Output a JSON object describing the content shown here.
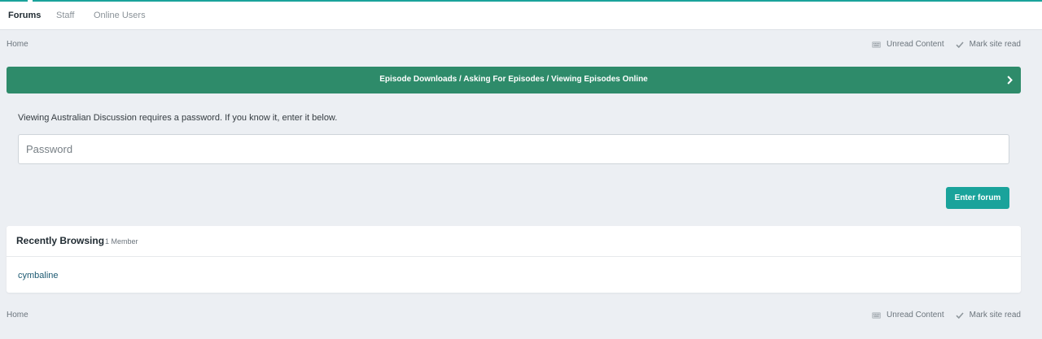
{
  "nav": {
    "tabs": [
      {
        "label": "Forums",
        "active": true
      },
      {
        "label": "Staff",
        "active": false
      },
      {
        "label": "Online Users",
        "active": false
      }
    ]
  },
  "breadcrumb_top": {
    "home": "Home",
    "unread": "Unread Content",
    "mark_read": "Mark site read"
  },
  "banner": {
    "text": "Episode Downloads / Asking For Episodes / Viewing Episodes Online",
    "color": "#2e8b6a"
  },
  "password_prompt": {
    "message": "Viewing Australian Discussion requires a password. If you know it, enter it below.",
    "placeholder": "Password",
    "value": "",
    "button": "Enter forum"
  },
  "recently_browsing": {
    "title": "Recently Browsing",
    "count": "1 Member",
    "members": [
      "cymbaline"
    ]
  },
  "breadcrumb_bottom": {
    "home": "Home",
    "unread": "Unread Content",
    "mark_read": "Mark site read"
  },
  "colors": {
    "accent": "#1aa39b",
    "background": "#eceff3",
    "link": "#1d5a72"
  }
}
